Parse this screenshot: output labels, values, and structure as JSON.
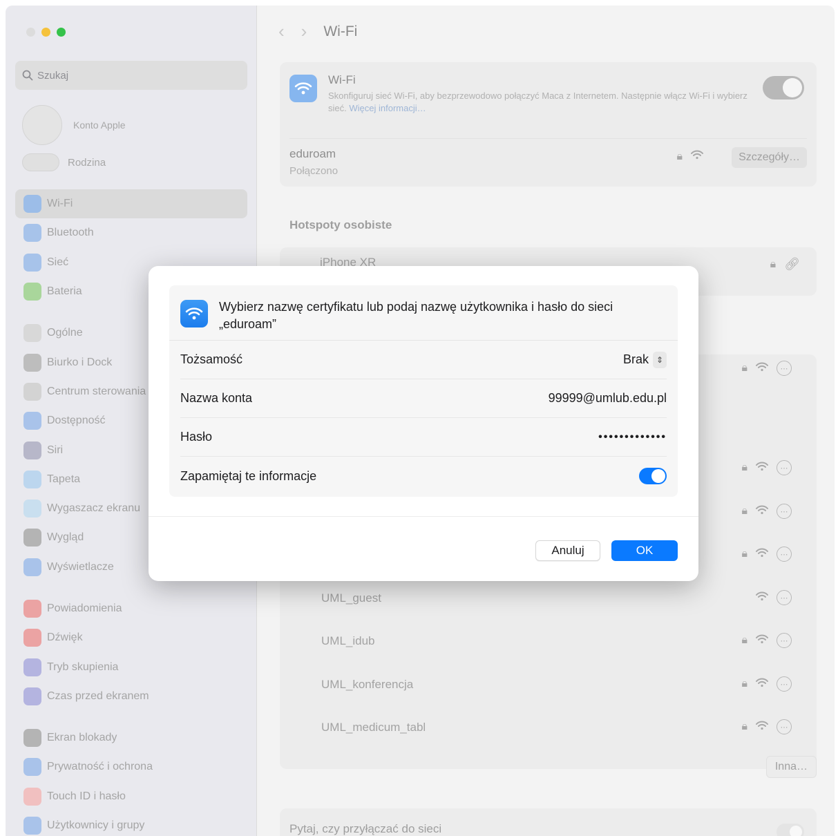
{
  "window": {
    "title": "Wi-Fi"
  },
  "sidebar": {
    "search_placeholder": "Szukaj",
    "account_label": "Konto Apple",
    "family_label": "Rodzina",
    "items": [
      {
        "label": "Wi-Fi",
        "color": "#9cbde8",
        "selected": true
      },
      {
        "label": "Bluetooth",
        "color": "#a7c3ea"
      },
      {
        "label": "Sieć",
        "color": "#a7c3ea"
      },
      {
        "label": "Bateria",
        "color": "#a9d69b"
      },
      {
        "label": "Ogólne",
        "color": "#d8d8d8"
      },
      {
        "label": "Biurko i Dock",
        "color": "#bdbdbd"
      },
      {
        "label": "Centrum sterowania",
        "color": "#d3d3d3"
      },
      {
        "label": "Dostępność",
        "color": "#a9c3ea"
      },
      {
        "label": "Siri",
        "color": "#b7b7c9"
      },
      {
        "label": "Tapeta",
        "color": "#bcd6ee"
      },
      {
        "label": "Wygaszacz ekranu",
        "color": "#c9dfef"
      },
      {
        "label": "Wygląd",
        "color": "#b4b4b4"
      },
      {
        "label": "Wyświetlacze",
        "color": "#a9c3ea"
      },
      {
        "label": "Powiadomienia",
        "color": "#eba3a3"
      },
      {
        "label": "Dźwięk",
        "color": "#eba3a3"
      },
      {
        "label": "Tryb skupienia",
        "color": "#b4b4e0"
      },
      {
        "label": "Czas przed ekranem",
        "color": "#b4b4e0"
      },
      {
        "label": "Ekran blokady",
        "color": "#b4b4b4"
      },
      {
        "label": "Prywatność i ochrona",
        "color": "#a9c3ea"
      },
      {
        "label": "Touch ID i hasło",
        "color": "#f1c0c0"
      },
      {
        "label": "Użytkownicy i grupy",
        "color": "#a9c3ea"
      }
    ]
  },
  "wifi": {
    "title": "Wi-Fi",
    "description": "Skonfiguruj sieć Wi-Fi, aby bezprzewodowo połączyć Maca z Internetem. Następnie włącz Wi-Fi i wybierz sieć.",
    "more_info": "Więcej informacji…",
    "current_network": "eduroam",
    "current_status": "Połączono",
    "details_button": "Szczegóły…"
  },
  "hotspots": {
    "heading": "Hotspoty osobiste",
    "network": "iPhone XR"
  },
  "networks": [
    {
      "name": "UML_guest",
      "locked": false
    },
    {
      "name": "UML_idub",
      "locked": true
    },
    {
      "name": "UML_konferencja",
      "locked": true
    },
    {
      "name": "UML_medicum_tabl",
      "locked": true
    }
  ],
  "other_button": "Inna…",
  "ask_join": "Pytaj, czy przyłączać do sieci",
  "dialog": {
    "title": "Wybierz nazwę certyfikatu lub podaj nazwę użytkownika i hasło do sieci „eduroam”",
    "identity_label": "Tożsamość",
    "identity_value": "Brak",
    "account_label": "Nazwa konta",
    "account_value": "99999@umlub.edu.pl",
    "password_label": "Hasło",
    "password_value": "•••••••••••••",
    "remember_label": "Zapamiętaj te informacje",
    "remember_on": true,
    "cancel_button": "Anuluj",
    "ok_button": "OK"
  }
}
